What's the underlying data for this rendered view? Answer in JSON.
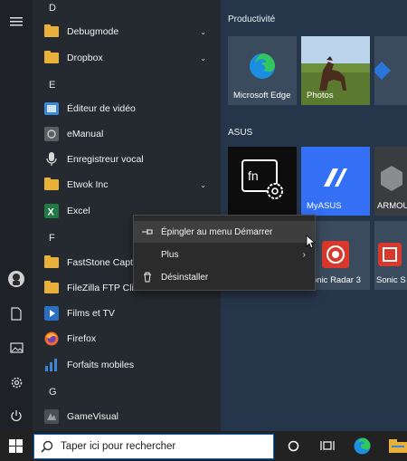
{
  "applist": {
    "letters": [
      "D",
      "E",
      "F",
      "G"
    ],
    "items": [
      {
        "label": "Debugmode"
      },
      {
        "label": "Dropbox"
      },
      {
        "label": "Éditeur de vidéo"
      },
      {
        "label": "eManual"
      },
      {
        "label": "Enregistreur vocal"
      },
      {
        "label": "Etwok Inc"
      },
      {
        "label": "Excel"
      },
      {
        "label": "FastStone Capture"
      },
      {
        "label": "FileZilla FTP Client"
      },
      {
        "label": "Films et TV"
      },
      {
        "label": "Firefox"
      },
      {
        "label": "Forfaits mobiles"
      },
      {
        "label": "GameVisual"
      }
    ]
  },
  "tiles": {
    "group1": "Productivité",
    "group2": "ASUS",
    "edge_label": "Microsoft Edge",
    "photos_label": "Photos",
    "myasus_label": "MyASUS",
    "armoury_label": "ARMOU",
    "sonic_radar_label": "onic Radar 3",
    "sonic_studio_label": "Sonic S"
  },
  "context_menu": {
    "pin_label": "Épingler au menu Démarrer",
    "more_label": "Plus",
    "uninstall_label": "Désinstaller"
  },
  "taskbar": {
    "search_placeholder": "Taper ici pour rechercher"
  },
  "colors": {
    "accent": "#0b6bcb",
    "folder": "#e9b13a",
    "myasus": "#3470f5"
  }
}
